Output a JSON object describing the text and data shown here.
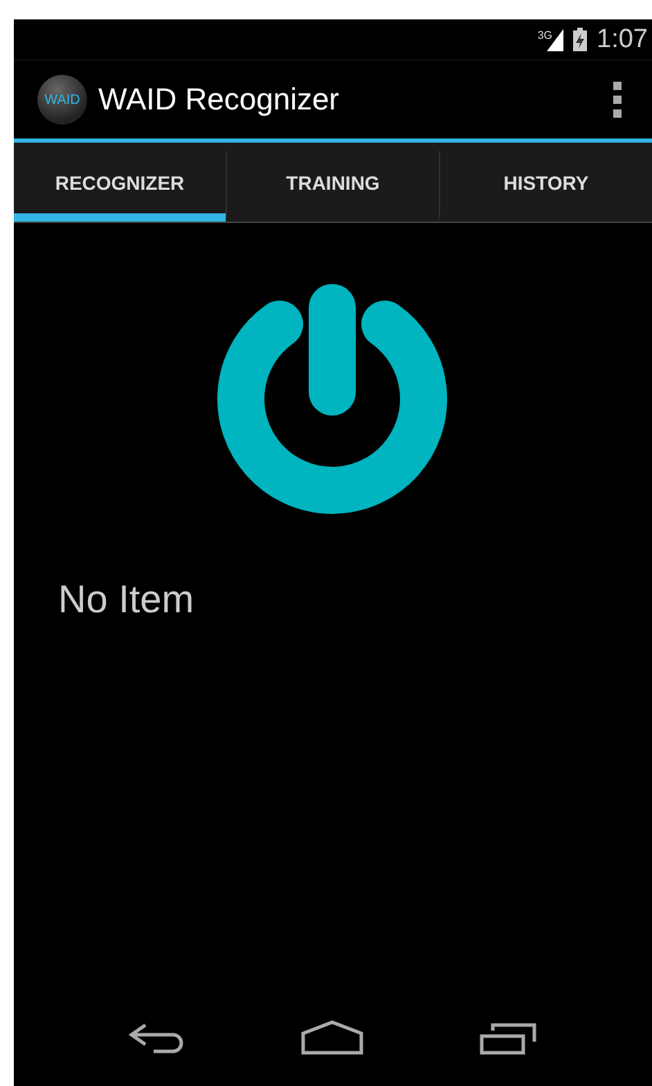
{
  "status_bar": {
    "network": "3G",
    "time": "1:07"
  },
  "action_bar": {
    "logo_text": "WAID",
    "title": "WAID Recognizer"
  },
  "tabs": [
    {
      "label": "RECOGNIZER",
      "selected": true
    },
    {
      "label": "TRAINING",
      "selected": false
    },
    {
      "label": "HISTORY",
      "selected": false
    }
  ],
  "content": {
    "message": "No Item"
  }
}
